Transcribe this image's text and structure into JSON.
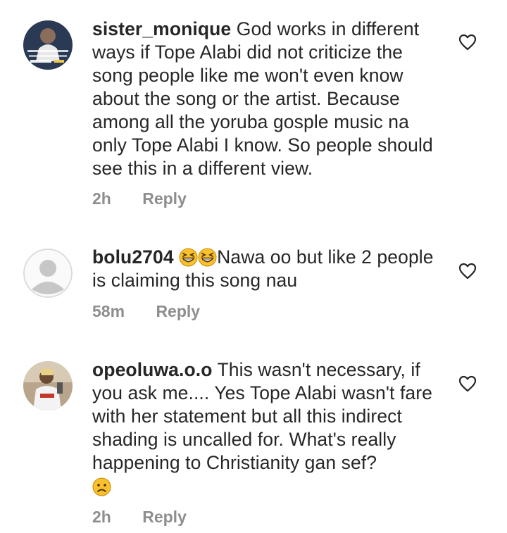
{
  "comments": [
    {
      "username": "sister_monique",
      "text": "God works in different ways if Tope Alabi did not criticize the song people like me won't even know about the song or the artist. Because among all the yoruba gosple music na only Tope Alabi I know. So people should see this in a different view.",
      "time": "2h",
      "reply_label": "Reply",
      "avatar_icon": "profile-photo",
      "like_icon": "heart-outline-icon"
    },
    {
      "username": "bolu2704",
      "emojis": [
        "grinning-squinting-face-emoji",
        "grinning-squinting-face-emoji"
      ],
      "text": "Nawa oo but like 2 people is claiming this song nau",
      "time": "58m",
      "reply_label": "Reply",
      "avatar_icon": "default-avatar-icon",
      "like_icon": "heart-outline-icon"
    },
    {
      "username": "opeoluwa.o.o",
      "text": "This wasn't necessary, if you ask me.... Yes Tope Alabi wasn't fare with her statement but all this indirect shading is uncalled for. What's really happening to Christianity gan sef?",
      "trailing_emoji": "frowning-face-emoji",
      "time": "2h",
      "reply_label": "Reply",
      "avatar_icon": "profile-photo",
      "like_icon": "heart-outline-icon"
    }
  ],
  "colors": {
    "text": "#262626",
    "meta": "#8e8e8e",
    "heart_stroke": "#262626",
    "default_avatar": "#c7c7c7",
    "emoji_yellow": "#fbc02d"
  }
}
